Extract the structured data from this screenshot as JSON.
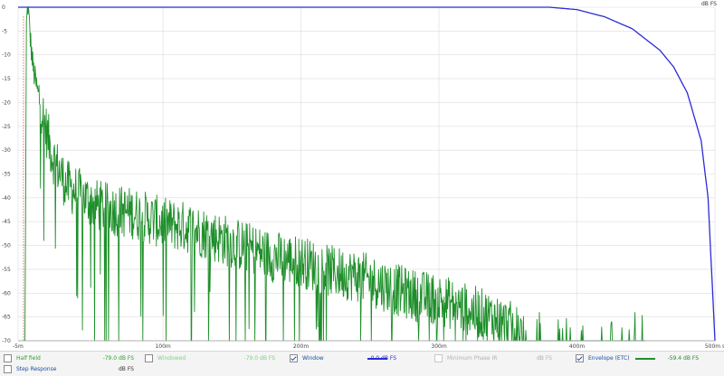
{
  "chart_data": {
    "type": "line",
    "ylabel": "dB FS",
    "xlabel": "",
    "xlim": [
      -0.005,
      0.5
    ],
    "ylim": [
      -70,
      0
    ],
    "grid": true,
    "x_ticks": [
      -0.005,
      0.1,
      0.2,
      0.3,
      0.4,
      0.5
    ],
    "x_tick_labels": [
      "-5m",
      "100m",
      "200m",
      "300m",
      "400m",
      "500m s"
    ],
    "y_ticks": [
      0,
      -5,
      -10,
      -15,
      -20,
      -25,
      -30,
      -35,
      -40,
      -45,
      -50,
      -55,
      -60,
      -65,
      -70
    ],
    "y_tick_labels": [
      "0",
      "-5",
      "-10",
      "-15",
      "-20",
      "-25",
      "-30",
      "-35",
      "-40",
      "-45",
      "-50",
      "-55",
      "-60",
      "-65",
      "-70"
    ],
    "series": [
      {
        "name": "Envelope (ETC)",
        "color": "#1e8f2a",
        "x": [
          0.0,
          0.001,
          0.002,
          0.004,
          0.006,
          0.008,
          0.01,
          0.015,
          0.02,
          0.03,
          0.04,
          0.05,
          0.06,
          0.08,
          0.1,
          0.12,
          0.14,
          0.16,
          0.18,
          0.2,
          0.22,
          0.24,
          0.26,
          0.28,
          0.3,
          0.32,
          0.34,
          0.36
        ],
        "y": [
          -70,
          -5,
          0,
          -8,
          -14,
          -17,
          -20,
          -27,
          -33,
          -39,
          -41,
          -43,
          -44,
          -45,
          -47,
          -48,
          -50,
          -52,
          -54,
          -55,
          -57,
          -58,
          -60,
          -62,
          -63,
          -65,
          -67,
          -70
        ]
      },
      {
        "name": "Window",
        "color": "#2b2bd8",
        "x": [
          -0.005,
          0.3,
          0.38,
          0.4,
          0.42,
          0.44,
          0.46,
          0.47,
          0.48,
          0.49,
          0.495,
          0.5
        ],
        "y": [
          0,
          0,
          0,
          -0.5,
          -2,
          -4.5,
          -9,
          -12.5,
          -18,
          -28,
          -40,
          -70
        ]
      }
    ]
  },
  "legend": [
    {
      "label": "Half field",
      "value": "-79.0 dB FS",
      "checked": false,
      "enabled": true,
      "label_color": "#2ca02c",
      "value_color": "#2ca02c",
      "swatch": ""
    },
    {
      "label": "Windowed",
      "value": "-79.0 dB FS",
      "checked": false,
      "enabled": true,
      "label_color": "#7fd07f",
      "value_color": "#7fd07f",
      "swatch": ""
    },
    {
      "label": "Window",
      "value": "0.0 dB FS",
      "checked": true,
      "enabled": true,
      "label_color": "#1a4ea0",
      "value_color": "#2b2bd8",
      "swatch": "#2b2bd8"
    },
    {
      "label": "Minimum Phase IR",
      "value": "dB FS",
      "checked": false,
      "enabled": false,
      "label_color": "#b0b0b0",
      "value_color": "#b0b0b0",
      "swatch": ""
    },
    {
      "label": "Envelope (ETC)",
      "value": "-59.4 dB FS",
      "checked": true,
      "enabled": true,
      "label_color": "#1a4ea0",
      "value_color": "#1e8f2a",
      "swatch": "#1e8f2a"
    },
    {
      "label": "Step Response",
      "value": "dB FS",
      "checked": false,
      "enabled": true,
      "label_color": "#1a4ea0",
      "value_color": "#333333",
      "swatch": ""
    }
  ]
}
